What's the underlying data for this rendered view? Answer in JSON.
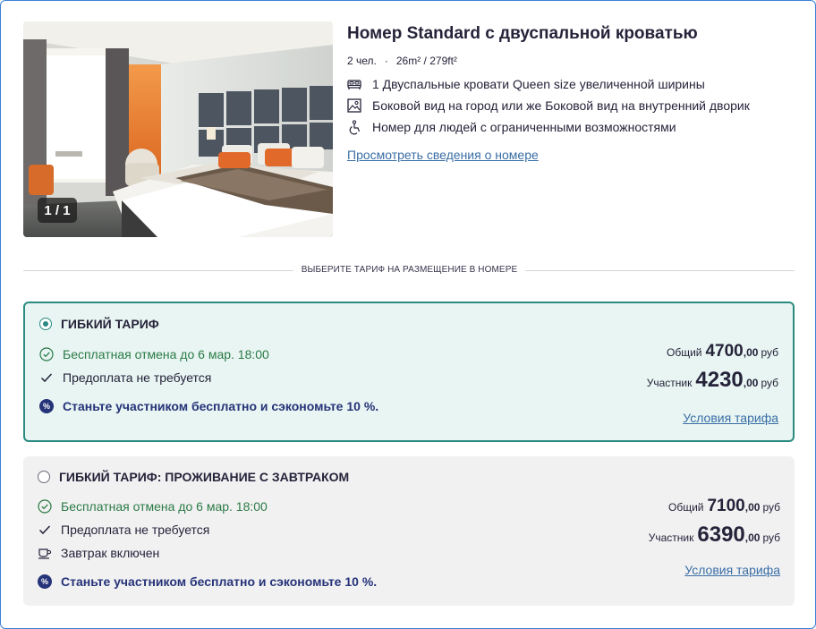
{
  "room": {
    "title": "Номер Standard с двуспальной кроватью",
    "guests": "2 чел.",
    "separator": "·",
    "area": "26m² / 279ft²",
    "photo_counter": "1 / 1",
    "features": [
      {
        "icon": "bed-icon",
        "text": "1 Двуспальные кровати Queen size увеличенной ширины"
      },
      {
        "icon": "view-icon",
        "text": "Боковой вид на город или же Боковой вид на внутренний дворик"
      },
      {
        "icon": "accessibility-icon",
        "text": "Номер для людей с ограниченными возможностями"
      }
    ],
    "details_link": "Просмотреть сведения о номере"
  },
  "divider": {
    "text": "ВЫБЕРИТЕ ТАРИФ НА РАЗМЕЩЕНИЕ В НОМЕРЕ"
  },
  "tariffs": [
    {
      "title": "ГИБКИЙ ТАРИФ",
      "selected": true,
      "cancellation": "Бесплатная отмена до 6 мар. 18:00",
      "prepayment": "Предоплата не требуется",
      "promo": "Станьте участником бесплатно и сэкономьте 10 %.",
      "promo_icon": "%",
      "total_label": "Общий",
      "total_price": "4700",
      "total_decimals": ",00",
      "total_currency": "руб",
      "member_label": "Участник",
      "member_price": "4230",
      "member_decimals": ",00",
      "member_currency": "руб",
      "conditions_link": "Условия тарифа"
    },
    {
      "title": "ГИБКИЙ ТАРИФ: ПРОЖИВАНИЕ С ЗАВТРАКОМ",
      "selected": false,
      "cancellation": "Бесплатная отмена до 6 мар. 18:00",
      "prepayment": "Предоплата не требуется",
      "breakfast": "Завтрак включен",
      "promo": "Станьте участником бесплатно и сэкономьте 10 %.",
      "promo_icon": "%",
      "total_label": "Общий",
      "total_price": "7100",
      "total_decimals": ",00",
      "total_currency": "руб",
      "member_label": "Участник",
      "member_price": "6390",
      "member_decimals": ",00",
      "member_currency": "руб",
      "conditions_link": "Условия тарифа"
    }
  ],
  "colors": {
    "accent_teal": "#2a8a81",
    "selected_bg": "#e8f5f3",
    "link": "#3a6ea5",
    "green_text": "#2b7a45",
    "promo_navy": "#253378",
    "frame_border": "#3c7fd6"
  }
}
